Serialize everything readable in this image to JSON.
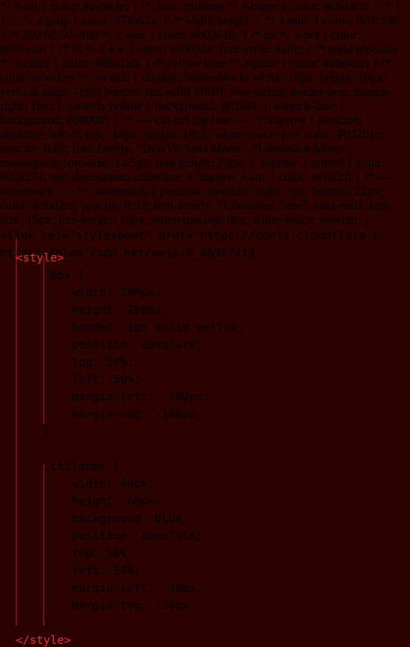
{
  "editor": {
    "background_color": "#2c0200",
    "language": "html-css",
    "truncated_top_line": {
      "text": "<link rel=\"stylesheet\" href=\"https://cdnjs.cloudflare.c",
      "visible": "partially cut off at top of screenshot"
    },
    "indent_guides": {
      "color": "#c4112a",
      "columns": [
        20,
        55
      ]
    }
  },
  "code": {
    "lines": [
      {
        "indent": 0,
        "tokens": [
          {
            "t": "tag",
            "v": "<style>"
          }
        ]
      },
      {
        "indent": 1,
        "tokens": [
          {
            "t": "sel",
            "v": ".box"
          },
          {
            "t": "sp",
            "v": " "
          },
          {
            "t": "brace",
            "v": "{"
          }
        ]
      },
      {
        "indent": 2,
        "tokens": [
          {
            "t": "prop",
            "v": "width"
          },
          {
            "t": "punc",
            "v": ": "
          },
          {
            "t": "num",
            "v": "200"
          },
          {
            "t": "unit",
            "v": "px"
          },
          {
            "t": "punc",
            "v": ";"
          }
        ]
      },
      {
        "indent": 2,
        "tokens": [
          {
            "t": "prop",
            "v": "height"
          },
          {
            "t": "punc",
            "v": ": "
          },
          {
            "t": "num",
            "v": "200"
          },
          {
            "t": "unit",
            "v": "px"
          },
          {
            "t": "punc",
            "v": ";"
          }
        ]
      },
      {
        "indent": 2,
        "tokens": [
          {
            "t": "prop",
            "v": "border"
          },
          {
            "t": "punc",
            "v": ": "
          },
          {
            "t": "num",
            "v": "1"
          },
          {
            "t": "unit",
            "v": "px"
          },
          {
            "t": "sp",
            "v": " "
          },
          {
            "t": "kw",
            "v": "solid"
          },
          {
            "t": "sp",
            "v": " "
          },
          {
            "t": "swatch",
            "v": "yellow"
          },
          {
            "t": "color",
            "v": "yellow"
          },
          {
            "t": "punc",
            "v": ";"
          }
        ]
      },
      {
        "indent": 2,
        "tokens": [
          {
            "t": "prop",
            "v": "position"
          },
          {
            "t": "punc",
            "v": ": "
          },
          {
            "t": "kw",
            "v": "absolute"
          },
          {
            "t": "punc",
            "v": ";"
          }
        ]
      },
      {
        "indent": 2,
        "tokens": [
          {
            "t": "prop",
            "v": "top"
          },
          {
            "t": "punc",
            "v": ": "
          },
          {
            "t": "num",
            "v": "50"
          },
          {
            "t": "pct",
            "v": "%"
          },
          {
            "t": "punc",
            "v": ";"
          }
        ]
      },
      {
        "indent": 2,
        "tokens": [
          {
            "t": "prop",
            "v": "left"
          },
          {
            "t": "punc",
            "v": ": "
          },
          {
            "t": "num",
            "v": "50"
          },
          {
            "t": "pct",
            "v": "%"
          },
          {
            "t": "punc",
            "v": ";"
          }
        ]
      },
      {
        "indent": 2,
        "tokens": [
          {
            "t": "prop",
            "v": "margin-left"
          },
          {
            "t": "punc",
            "v": ": "
          },
          {
            "t": "num",
            "v": "-100"
          },
          {
            "t": "unit",
            "v": "px"
          },
          {
            "t": "punc",
            "v": ";"
          }
        ]
      },
      {
        "indent": 2,
        "tokens": [
          {
            "t": "prop",
            "v": "margin-top"
          },
          {
            "t": "punc",
            "v": ": "
          },
          {
            "t": "num",
            "v": "-100"
          },
          {
            "t": "unit",
            "v": "px"
          },
          {
            "t": "punc",
            "v": ";"
          }
        ]
      },
      {
        "indent": 1,
        "tokens": [
          {
            "t": "brace",
            "v": "}"
          }
        ]
      },
      {
        "indent": 0,
        "tokens": []
      },
      {
        "indent": 1,
        "tokens": [
          {
            "t": "sel",
            "v": ".children"
          },
          {
            "t": "sp",
            "v": " "
          },
          {
            "t": "brace",
            "v": "{"
          }
        ]
      },
      {
        "indent": 2,
        "tokens": [
          {
            "t": "prop",
            "v": "width"
          },
          {
            "t": "punc",
            "v": ": "
          },
          {
            "t": "num",
            "v": "60"
          },
          {
            "t": "unit",
            "v": "px"
          },
          {
            "t": "punc",
            "v": ";"
          }
        ]
      },
      {
        "indent": 2,
        "tokens": [
          {
            "t": "prop",
            "v": "height"
          },
          {
            "t": "punc",
            "v": ": "
          },
          {
            "t": "num",
            "v": "60"
          },
          {
            "t": "unit",
            "v": "px"
          },
          {
            "t": "punc",
            "v": ";"
          }
        ]
      },
      {
        "indent": 2,
        "tokens": [
          {
            "t": "prop",
            "v": "background"
          },
          {
            "t": "punc",
            "v": ": "
          },
          {
            "t": "swatch",
            "v": "blue"
          },
          {
            "t": "color",
            "v": "blue"
          },
          {
            "t": "punc",
            "v": ";"
          }
        ]
      },
      {
        "indent": 2,
        "tokens": [
          {
            "t": "prop",
            "v": "position"
          },
          {
            "t": "punc",
            "v": ": "
          },
          {
            "t": "kw",
            "v": "absolute"
          },
          {
            "t": "punc",
            "v": ";"
          }
        ]
      },
      {
        "indent": 2,
        "tokens": [
          {
            "t": "prop",
            "v": "top"
          },
          {
            "t": "punc",
            "v": ": "
          },
          {
            "t": "num",
            "v": "50"
          },
          {
            "t": "pct",
            "v": "%"
          },
          {
            "t": "punc",
            "v": ";"
          }
        ]
      },
      {
        "indent": 2,
        "tokens": [
          {
            "t": "prop",
            "v": "left"
          },
          {
            "t": "punc",
            "v": ": "
          },
          {
            "t": "num",
            "v": "50"
          },
          {
            "t": "pct",
            "v": "%"
          },
          {
            "t": "punc",
            "v": ";"
          }
        ]
      },
      {
        "indent": 2,
        "tokens": [
          {
            "t": "prop",
            "v": "margin-left"
          },
          {
            "t": "punc",
            "v": ": "
          },
          {
            "t": "num",
            "v": "-30"
          },
          {
            "t": "unit",
            "v": "px"
          },
          {
            "t": "punc",
            "v": ";"
          }
        ]
      },
      {
        "indent": 2,
        "tokens": [
          {
            "t": "prop",
            "v": "margin-top"
          },
          {
            "t": "punc",
            "v": ": "
          },
          {
            "t": "num",
            "v": "-30"
          },
          {
            "t": "unit",
            "v": "px"
          },
          {
            "t": "punc",
            "v": ";"
          }
        ]
      },
      {
        "indent": 1,
        "tokens": [
          {
            "t": "brace",
            "v": "}"
          }
        ]
      },
      {
        "indent": 0,
        "tokens": [
          {
            "t": "tag",
            "v": "</style>"
          }
        ]
      }
    ]
  },
  "swatch_colors": {
    "yellow": "#ffff00",
    "blue": "#0000ff"
  },
  "token_colors": {
    "tag": "#e33030",
    "selector": "#2e9e3e",
    "property": "#7fb62a",
    "number": "#e0c336",
    "unit": "#b02618",
    "percent": "#d01a1a",
    "keyword": "#e0b93a",
    "color_name": "#d6a1a8",
    "punctuation": "#d8d4cc"
  },
  "watermark": {
    "text": "https://blog.csdn.net/weixin_46957313"
  }
}
